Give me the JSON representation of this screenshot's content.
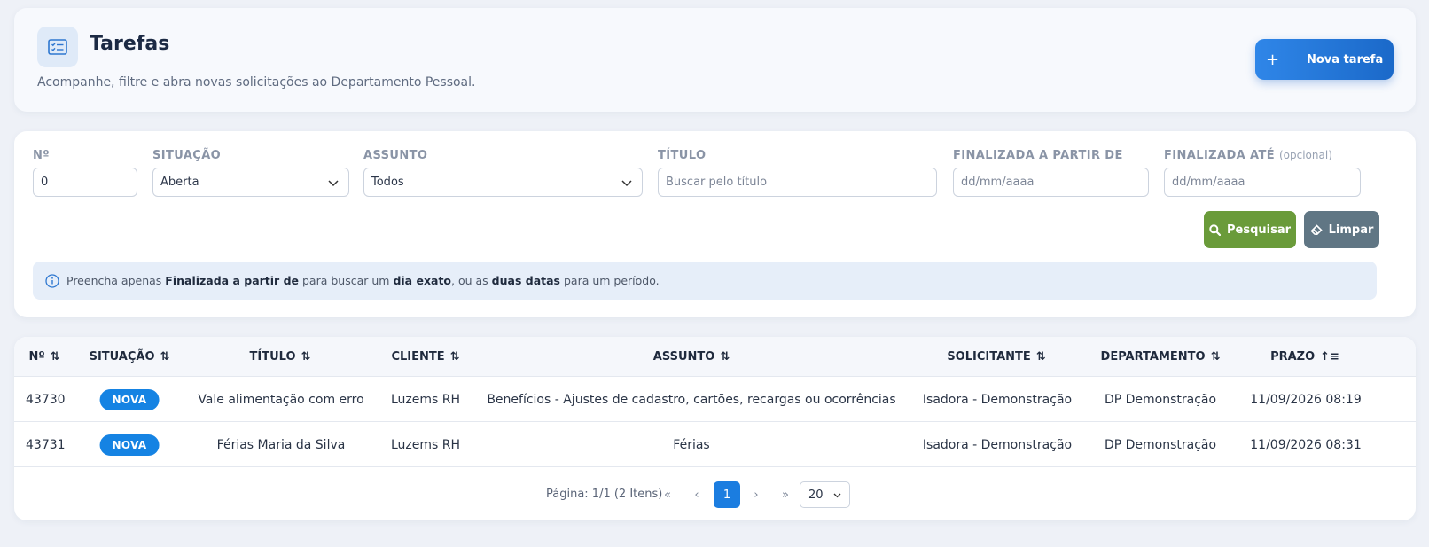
{
  "header": {
    "title": "Tarefas",
    "subtitle": "Acompanhe, filtre e abra novas solicitações ao Departamento Pessoal.",
    "new_button": "Nova tarefa",
    "new_button_icon": "+"
  },
  "filters": {
    "num": {
      "label": "Nº",
      "value": "0"
    },
    "situacao": {
      "label": "SITUAÇÃO",
      "value": "Aberta"
    },
    "assunto": {
      "label": "ASSUNTO",
      "value": "Todos"
    },
    "titulo": {
      "label": "TÍTULO",
      "placeholder": "Buscar pelo título"
    },
    "finalizada_de": {
      "label": "FINALIZADA A PARTIR DE",
      "placeholder": "dd/mm/aaaa"
    },
    "finalizada_ate": {
      "label": "FINALIZADA ATÉ",
      "optional": "(opcional)",
      "placeholder": "dd/mm/aaaa"
    },
    "search_button": "Pesquisar",
    "clear_button": "Limpar",
    "info": {
      "t1": "Preencha apenas",
      "b1": "Finalizada a partir de",
      "t2": "para buscar um",
      "b2": "dia exato",
      "t3": ", ou as",
      "b3": "duas datas",
      "t4": "para um período."
    }
  },
  "table": {
    "columns": [
      "Nº",
      "SITUAÇÃO",
      "TÍTULO",
      "CLIENTE",
      "ASSUNTO",
      "SOLICITANTE",
      "DEPARTAMENTO",
      "PRAZO"
    ],
    "rows": [
      {
        "num": "43730",
        "situacao": "NOVA",
        "titulo": "Vale alimentação com erro",
        "cliente": "Luzems RH",
        "assunto": "Benefícios - Ajustes de cadastro, cartões, recargas ou ocorrências",
        "solicitante": "Isadora - Demonstração",
        "departamento": "DP Demonstração",
        "prazo": "11/09/2026 08:19"
      },
      {
        "num": "43731",
        "situacao": "NOVA",
        "titulo": "Férias Maria da Silva",
        "cliente": "Luzems RH",
        "assunto": "Férias",
        "solicitante": "Isadora - Demonstração",
        "departamento": "DP Demonstração",
        "prazo": "11/09/2026 08:31"
      }
    ],
    "badge_color": "#1583e3"
  },
  "pagination": {
    "info": "Página: 1/1 (2 Itens)",
    "current_page": "1",
    "page_size": "20",
    "first": "«",
    "prev": "‹",
    "next": "›",
    "last": "»"
  },
  "colors": {
    "primary": "#1b7de0",
    "search": "#6a9b3a",
    "clear": "#607684"
  }
}
